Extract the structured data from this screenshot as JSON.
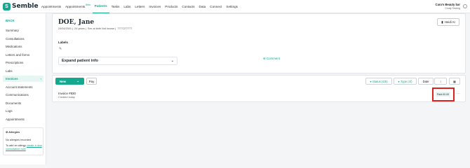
{
  "brand": {
    "name": "Semble",
    "mark": "S"
  },
  "nav": {
    "items": [
      {
        "label": "Appointments"
      },
      {
        "label": "Appointments",
        "badge": "Beta"
      },
      {
        "label": "Patients",
        "active": true
      },
      {
        "label": "Tasks"
      },
      {
        "label": "Labs"
      },
      {
        "label": "Letters"
      },
      {
        "label": "Invoices"
      },
      {
        "label": "Products"
      },
      {
        "label": "Contacts"
      },
      {
        "label": "Data"
      },
      {
        "label": "Connect"
      },
      {
        "label": "Settings"
      }
    ]
  },
  "user": {
    "name": "Cara's Beauty bar",
    "sub": "Cindy Testing"
  },
  "sidebar": {
    "back_label": "BACK",
    "items": [
      {
        "label": "Summary"
      },
      {
        "label": "Consultations"
      },
      {
        "label": "Medications"
      },
      {
        "label": "Letters and forms"
      },
      {
        "label": "Prescriptions"
      },
      {
        "label": "Labs"
      },
      {
        "label": "Invoices",
        "active": true
      },
      {
        "label": "Account statements"
      },
      {
        "label": "Communications"
      },
      {
        "label": "Documents"
      },
      {
        "label": "Logs"
      },
      {
        "label": "Appointments"
      }
    ],
    "allergies": {
      "title": "Allergies",
      "none_text": "No allergies recorded",
      "add_prefix": "To add an allergy",
      "add_link": "create a new consultation note"
    }
  },
  "patient": {
    "name": "DOE, Jane",
    "dob": "24/04/2001",
    "age": "24 years",
    "sex": "Sex at birth Not known",
    "phone": "7777277777"
  },
  "header_actions": {
    "heidi_label": "Heidi AI"
  },
  "labels": {
    "title": "Labels"
  },
  "patient_info": {
    "expand_label": "Expand patient info"
  },
  "comment": {
    "label": "Comment"
  },
  "invoices_toolbar": {
    "new_label": "New",
    "pay_label": "Pay",
    "status_label": "Status (4/5)",
    "type_label": "Type (4/)",
    "date_label": "Date",
    "sort_label": "↕"
  },
  "invoices": [
    {
      "title": "Invoice #830",
      "created": "Created today",
      "status": "Paid £0.00"
    }
  ],
  "colors": {
    "accent": "#14a88f",
    "highlight": "#e0201c"
  }
}
